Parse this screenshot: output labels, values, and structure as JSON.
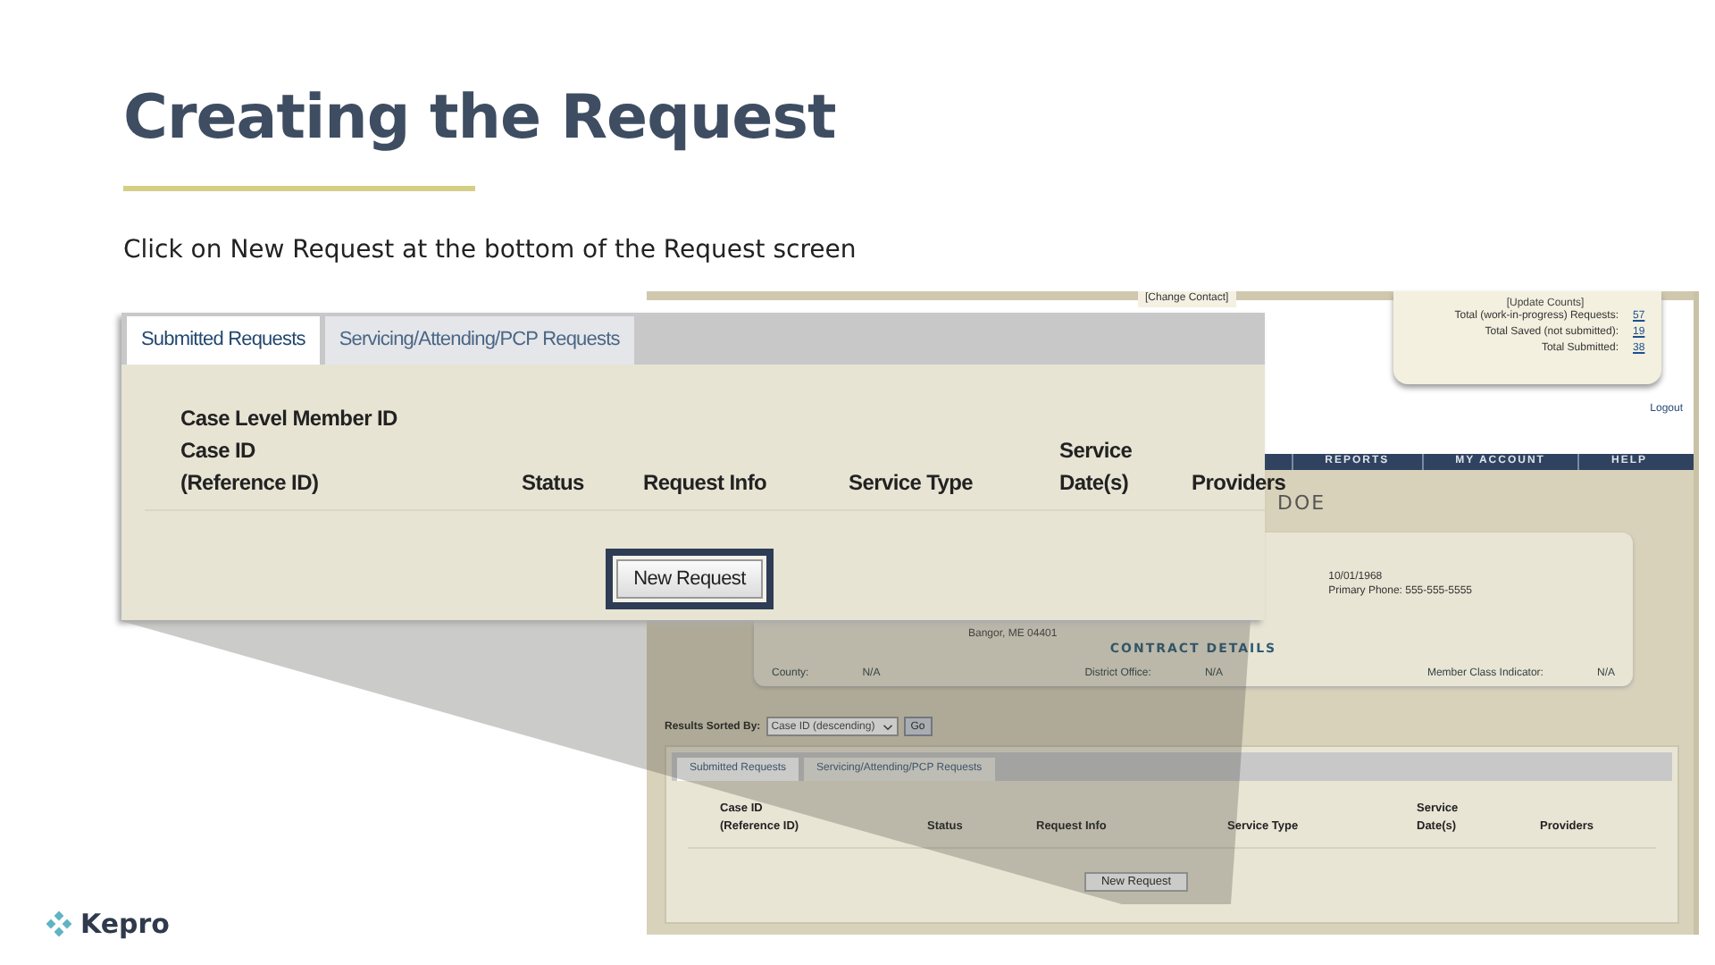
{
  "slide": {
    "title": "Creating the Request",
    "subtitle": "Click on New Request at the bottom of the Request screen",
    "logo": "Kepro"
  },
  "background_screen": {
    "change_contact": "[Change Contact]",
    "counts": {
      "update": "[Update Counts]",
      "rows": [
        {
          "label": "Total (work-in-progress) Requests:",
          "value": "57"
        },
        {
          "label": "Total Saved (not submitted):",
          "value": "19"
        },
        {
          "label": "Total Submitted:",
          "value": "38"
        }
      ]
    },
    "logout": "Logout",
    "nav": [
      {
        "label": "REPORTS"
      },
      {
        "label": "MY ACCOUNT"
      },
      {
        "label": "HELP"
      }
    ],
    "member_name": "DOE",
    "member_card": {
      "address": "Bangor, ME 04401",
      "birth_date": "10/01/1968",
      "phone": "Primary Phone: 555-555-5555",
      "section_title": "CONTRACT DETAILS",
      "fields": [
        {
          "label": "County:",
          "value": "N/A"
        },
        {
          "label": "District Office:",
          "value": "N/A"
        },
        {
          "label": "Member Class Indicator:",
          "value": "N/A"
        }
      ]
    },
    "sort": {
      "label": "Results Sorted By:",
      "value": "Case ID (descending)",
      "button": "Go"
    },
    "tabs": [
      {
        "label": "Submitted Requests",
        "selected": true
      },
      {
        "label": "Servicing/Attending/PCP Requests",
        "selected": false
      }
    ],
    "columns": [
      {
        "lines": [
          "Case ID",
          "(Reference ID)"
        ]
      },
      {
        "lines": [
          "Status"
        ]
      },
      {
        "lines": [
          "Request Info"
        ]
      },
      {
        "lines": [
          "Service Type"
        ]
      },
      {
        "lines": [
          "Service",
          "Date(s)"
        ]
      },
      {
        "lines": [
          "Providers"
        ]
      }
    ],
    "button": {
      "label": "New Request",
      "highlighted": false
    }
  },
  "callout": {
    "tabs": [
      {
        "label": "Submitted Requests",
        "selected": true
      },
      {
        "label": "Servicing/Attending/PCP Requests",
        "selected": false
      }
    ],
    "columns": [
      {
        "lines": [
          "Case Level Member ID",
          "Case ID",
          "(Reference ID)"
        ]
      },
      {
        "lines": [
          "Status"
        ]
      },
      {
        "lines": [
          "Request Info"
        ]
      },
      {
        "lines": [
          "Service Type"
        ]
      },
      {
        "lines": [
          "Service",
          "Date(s)"
        ]
      },
      {
        "lines": [
          "Providers"
        ]
      }
    ],
    "button": {
      "label": "New Request",
      "highlighted": true
    }
  }
}
